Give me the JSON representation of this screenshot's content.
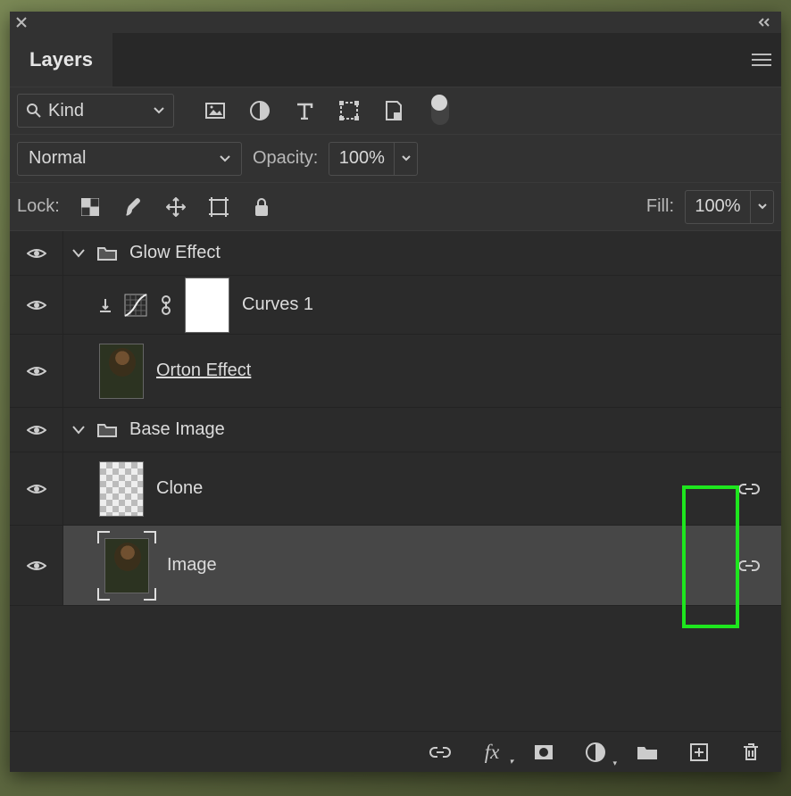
{
  "tab": {
    "layers": "Layers"
  },
  "filter": {
    "kind_label": "Kind"
  },
  "blend": {
    "mode": "Normal",
    "opacity_label": "Opacity:",
    "opacity_value": "100%"
  },
  "lock": {
    "label": "Lock:",
    "fill_label": "Fill:",
    "fill_value": "100%"
  },
  "layers": {
    "group1_name": "Glow Effect",
    "curves_name": "Curves 1",
    "orton_name": "Orton Effect",
    "group2_name": "Base Image",
    "clone_name": "Clone",
    "image_name": "Image"
  }
}
